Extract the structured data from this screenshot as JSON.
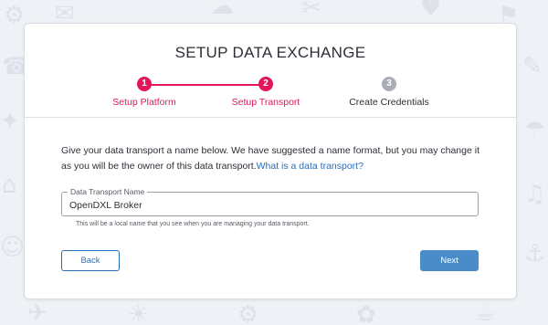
{
  "dialog": {
    "title": "SETUP DATA EXCHANGE"
  },
  "steps": [
    {
      "number": "1",
      "label": "Setup Platform",
      "state": "completed"
    },
    {
      "number": "2",
      "label": "Setup Transport",
      "state": "active"
    },
    {
      "number": "3",
      "label": "Create Credentials",
      "state": "pending"
    }
  ],
  "description": {
    "text": "Give your data transport a name below. We have suggested a name format, but you may change it as you will be the owner of this data transport.",
    "link": "What is a data transport?"
  },
  "transport_name": {
    "label": "Data Transport Name",
    "value": "OpenDXL Broker",
    "hint": "This will be a local name that you see when you are managing your data transport."
  },
  "buttons": {
    "back": "Back",
    "next": "Next"
  },
  "colors": {
    "accent": "#e3165b",
    "link": "#2a6ebb",
    "primary_button": "#4a8bc9",
    "inactive_step": "#a9adb5"
  }
}
